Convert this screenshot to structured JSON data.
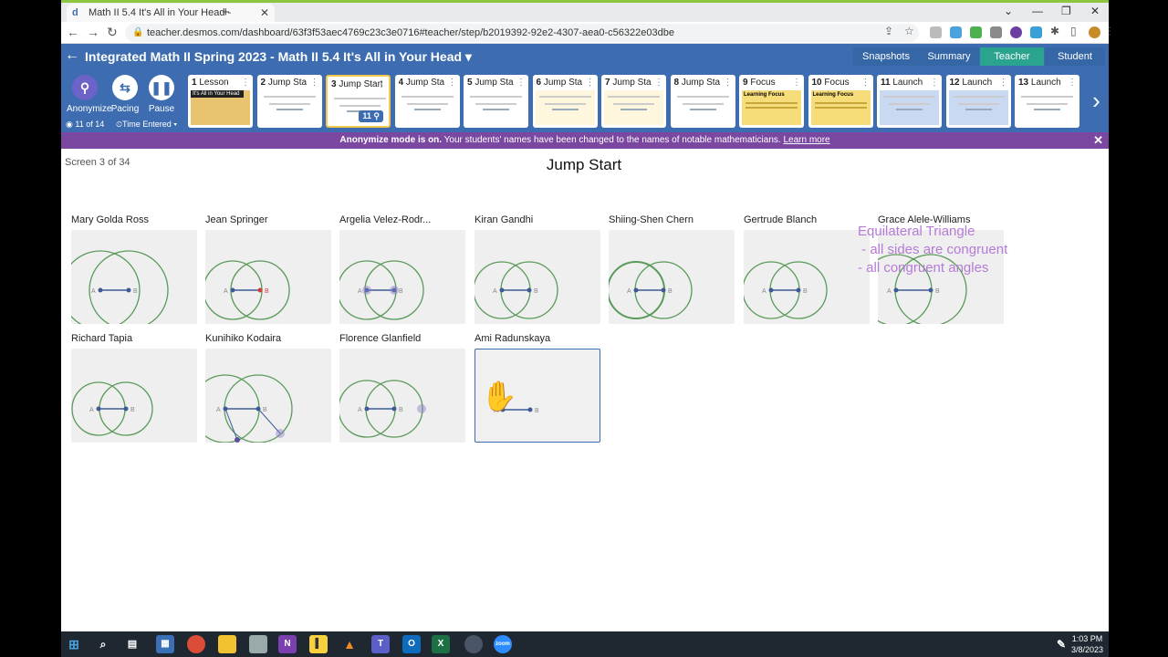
{
  "browser": {
    "tab_title": "Math II 5.4 It's All in Your Head -",
    "url": "teacher.desmos.com/dashboard/63f3f53aec4769c23c3e0716#teacher/step/b2019392-92e2-4307-aea0-c56322e03dbe"
  },
  "header": {
    "title": "Integrated Math II Spring 2023 - Math II 5.4 It's All in Your Head",
    "buttons": [
      "Snapshots",
      "Summary",
      "Teacher",
      "Student"
    ],
    "active": "Teacher"
  },
  "tools": {
    "anonymize": "Anonymize",
    "pacing": "Pacing",
    "pause": "Pause",
    "progress": "11 of 14",
    "sort": "Time Entered"
  },
  "screens": [
    {
      "num": "1",
      "label": "Lesson"
    },
    {
      "num": "2",
      "label": "Jump Sta"
    },
    {
      "num": "3",
      "label": "Jump Start",
      "count": "11"
    },
    {
      "num": "4",
      "label": "Jump Sta"
    },
    {
      "num": "5",
      "label": "Jump Sta"
    },
    {
      "num": "6",
      "label": "Jump Sta"
    },
    {
      "num": "7",
      "label": "Jump Sta"
    },
    {
      "num": "8",
      "label": "Jump Sta"
    },
    {
      "num": "9",
      "label": "Focus"
    },
    {
      "num": "10",
      "label": "Focus"
    },
    {
      "num": "11",
      "label": "Launch"
    },
    {
      "num": "12",
      "label": "Launch"
    },
    {
      "num": "13",
      "label": "Launch"
    }
  ],
  "thumb_text": {
    "lesson": "It's All in Your Head",
    "focus": "Learning Focus"
  },
  "banner": {
    "bold": "Anonymize mode is on.",
    "text": " Your students' names have been changed to the names of notable mathematicians. ",
    "link": "Learn more"
  },
  "main": {
    "screen_info": "Screen 3 of 34",
    "title": "Jump Start"
  },
  "students": [
    "Mary Golda Ross",
    "Jean Springer",
    "Argelia Velez-Rodr...",
    "Kiran Gandhi",
    "Shiing-Shen Chern",
    "Gertrude Blanch",
    "Grace Alele-Williams",
    "Richard Tapia",
    "Kunihiko Kodaira",
    "Florence Glanfield",
    "Ami Radunskaya"
  ],
  "point_labels": {
    "a": "A",
    "b": "B"
  },
  "annotation": {
    "line1": "Equilateral Triangle",
    "line2": " - all sides are congruent",
    "line3": "- all congruent angles"
  },
  "clock": {
    "time": "1:03 PM",
    "date": "3/8/2023"
  },
  "colors": {
    "header": "#3d6db0",
    "banner": "#7a48a0",
    "teacher_active": "#2aa38f",
    "annotation": "#b57bd6",
    "circle": "#5a9a5a"
  }
}
